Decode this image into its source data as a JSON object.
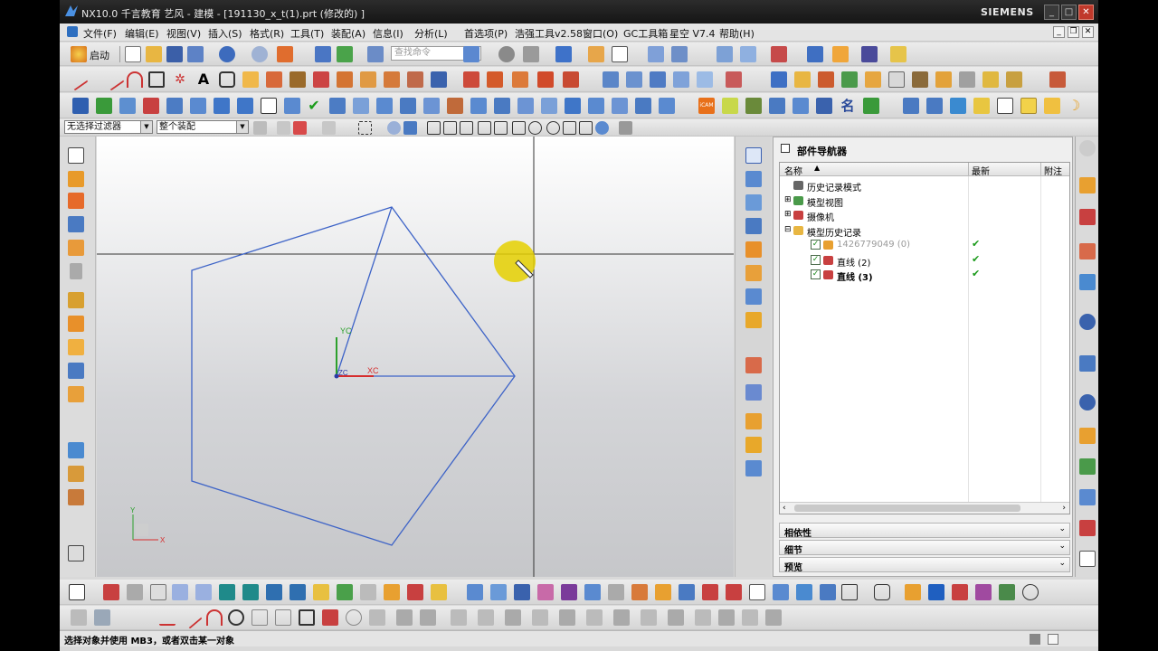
{
  "window": {
    "title": "NX10.0 千言教育 艺风 - 建模 - [191130_x_t(1).prt  (修改的) ]",
    "brand": "SIEMENS",
    "controls": [
      "_",
      "□",
      "✕"
    ]
  },
  "menu": {
    "items": [
      "文件(F)",
      "编辑(E)",
      "视图(V)",
      "插入(S)",
      "格式(R)",
      "工具(T)",
      "装配(A)",
      "信息(I)",
      "分析(L)",
      "首选项(P)",
      "浩强工具v2.58",
      "窗口(O)",
      "GC工具箱",
      "星空 V7.4",
      "帮助(H)"
    ],
    "mdi_controls": [
      "_",
      "❐",
      "✕"
    ]
  },
  "toolbar": {
    "start_label": "启动",
    "search_placeholder": "查找命令"
  },
  "filters": {
    "selection_filter": "无选择过滤器",
    "assembly_scope": "整个装配"
  },
  "viewport": {
    "axis_labels": {
      "xc": "XC",
      "yc": "YC",
      "zc": "ZC",
      "x": "X",
      "y": "Y"
    }
  },
  "navigator": {
    "title": "部件导航器",
    "columns": {
      "name": "名称",
      "latest": "最新",
      "note": "附注"
    },
    "rows": [
      {
        "label": "历史记录模式",
        "indent": 0,
        "expander": "",
        "checked": null,
        "latest": false
      },
      {
        "label": "模型视图",
        "indent": 0,
        "expander": "+",
        "checked": null,
        "latest": false
      },
      {
        "label": "摄像机",
        "indent": 0,
        "expander": "+",
        "checked": null,
        "latest": false
      },
      {
        "label": "模型历史记录",
        "indent": 0,
        "expander": "−",
        "checked": null,
        "latest": false
      },
      {
        "label": "1426779049 (0)",
        "indent": 1,
        "expander": "",
        "checked": true,
        "latest": true
      },
      {
        "label": "直线 (2)",
        "indent": 1,
        "expander": "",
        "checked": true,
        "latest": true
      },
      {
        "label": "直线 (3)",
        "indent": 1,
        "expander": "",
        "checked": true,
        "latest": true
      }
    ],
    "panels": [
      "相依性",
      "细节",
      "预览"
    ]
  },
  "status": {
    "text": "选择对象并使用 MB3，或者双击某一对象"
  }
}
